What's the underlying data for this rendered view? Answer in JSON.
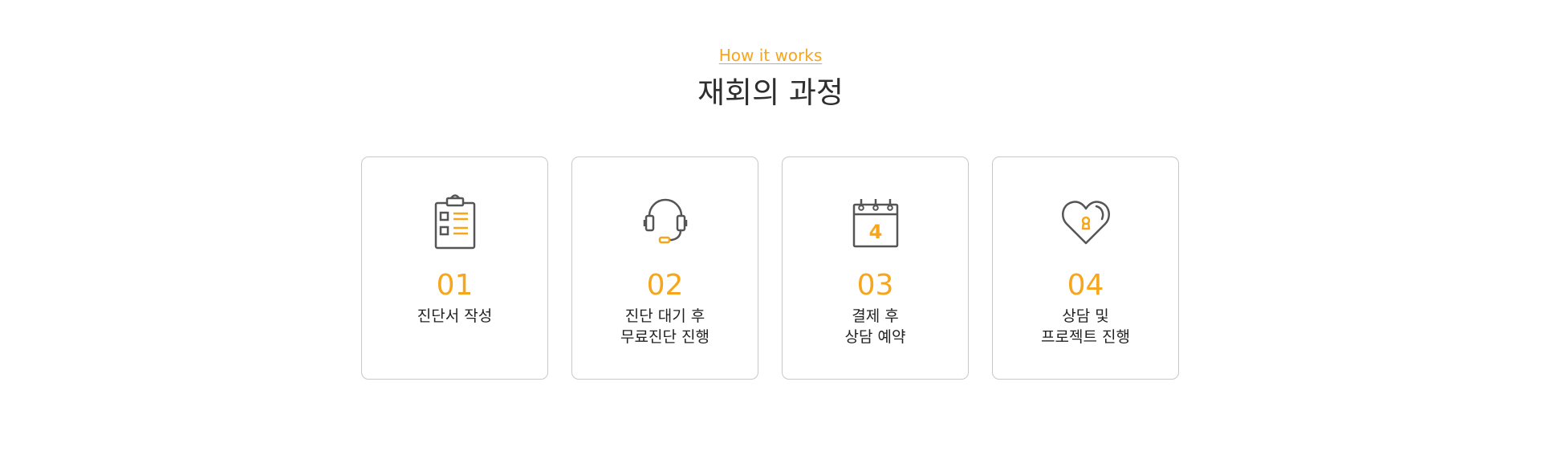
{
  "section": {
    "eyebrow": "How it works",
    "title": "재회의 과정"
  },
  "steps": [
    {
      "number": "01",
      "lines": [
        "진단서 작성"
      ],
      "icon": "clipboard-checklist-icon"
    },
    {
      "number": "02",
      "lines": [
        "진단 대기 후",
        "무료진단 진행"
      ],
      "icon": "headset-icon"
    },
    {
      "number": "03",
      "lines": [
        "결제 후",
        "상담 예약"
      ],
      "icon": "calendar-icon",
      "calendar_day": "4"
    },
    {
      "number": "04",
      "lines": [
        "상담 및",
        "프로젝트 진행"
      ],
      "icon": "heart-lock-icon"
    }
  ],
  "colors": {
    "accent": "#f7a51b",
    "icon_stroke": "#555555",
    "card_border": "#c8c8c8",
    "text": "#222222"
  }
}
